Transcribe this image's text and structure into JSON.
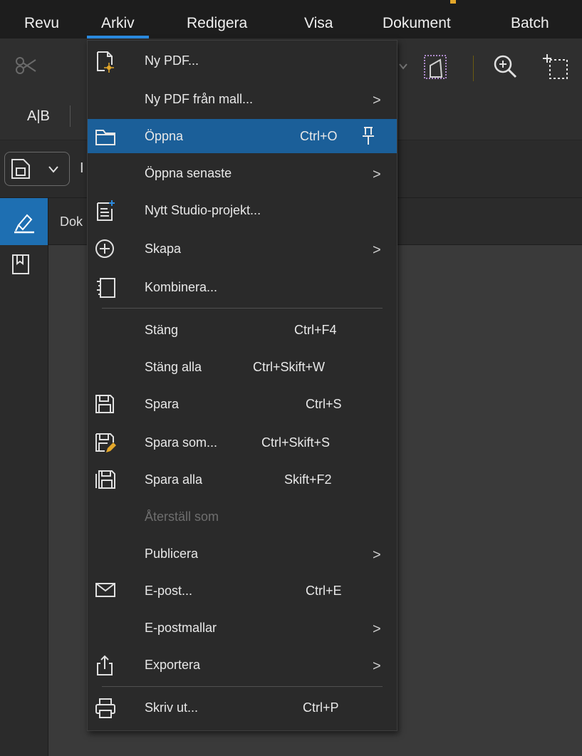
{
  "menubar": {
    "items": [
      {
        "label": "Revu"
      },
      {
        "label": "Arkiv"
      },
      {
        "label": "Redigera"
      },
      {
        "label": "Visa"
      },
      {
        "label": "Dokument"
      },
      {
        "label": "Batch"
      }
    ],
    "active_index": 1
  },
  "document_tab": {
    "label": "Dok"
  },
  "toolbar": {
    "text_tool_label": "A|B",
    "partial_label": "I"
  },
  "file_menu": {
    "items": [
      {
        "label": "Ny PDF...",
        "icon": "new-pdf-icon"
      },
      {
        "label": "Ny PDF från mall...",
        "submenu": ">"
      },
      {
        "label": "Öppna",
        "shortcut": "Ctrl+O",
        "icon": "folder-icon",
        "highlighted": true,
        "pin": "pin-icon"
      },
      {
        "label": "Öppna senaste",
        "submenu": ">"
      },
      {
        "label": "Nytt Studio-projekt...",
        "icon": "studio-project-icon"
      },
      {
        "label": "Skapa",
        "icon": "plus-circle-icon",
        "submenu": ">"
      },
      {
        "label": "Kombinera...",
        "icon": "combine-icon"
      },
      {
        "label": "Stäng",
        "shortcut": "Ctrl+F4"
      },
      {
        "label": "Stäng alla",
        "shortcut": "Ctrl+Skift+W"
      },
      {
        "label": "Spara",
        "shortcut": "Ctrl+S",
        "icon": "save-icon"
      },
      {
        "label": "Spara som...",
        "shortcut": "Ctrl+Skift+S",
        "icon": "save-as-icon"
      },
      {
        "label": "Spara alla",
        "shortcut": "Skift+F2",
        "icon": "save-all-icon"
      },
      {
        "label": "Återställ som",
        "disabled": true
      },
      {
        "label": "Publicera",
        "submenu": ">"
      },
      {
        "label": "E-post...",
        "shortcut": "Ctrl+E",
        "icon": "mail-icon"
      },
      {
        "label": "E-postmallar",
        "submenu": ">"
      },
      {
        "label": "Exportera",
        "icon": "export-icon",
        "submenu": ">"
      },
      {
        "label": "Skriv ut...",
        "shortcut": "Ctrl+P",
        "icon": "print-icon"
      }
    ]
  },
  "colors": {
    "accent": "#2b8be0",
    "highlight": "#1b5f99",
    "menu_bg": "#2a2a2a",
    "menubar_bg": "#1d1d1d"
  }
}
